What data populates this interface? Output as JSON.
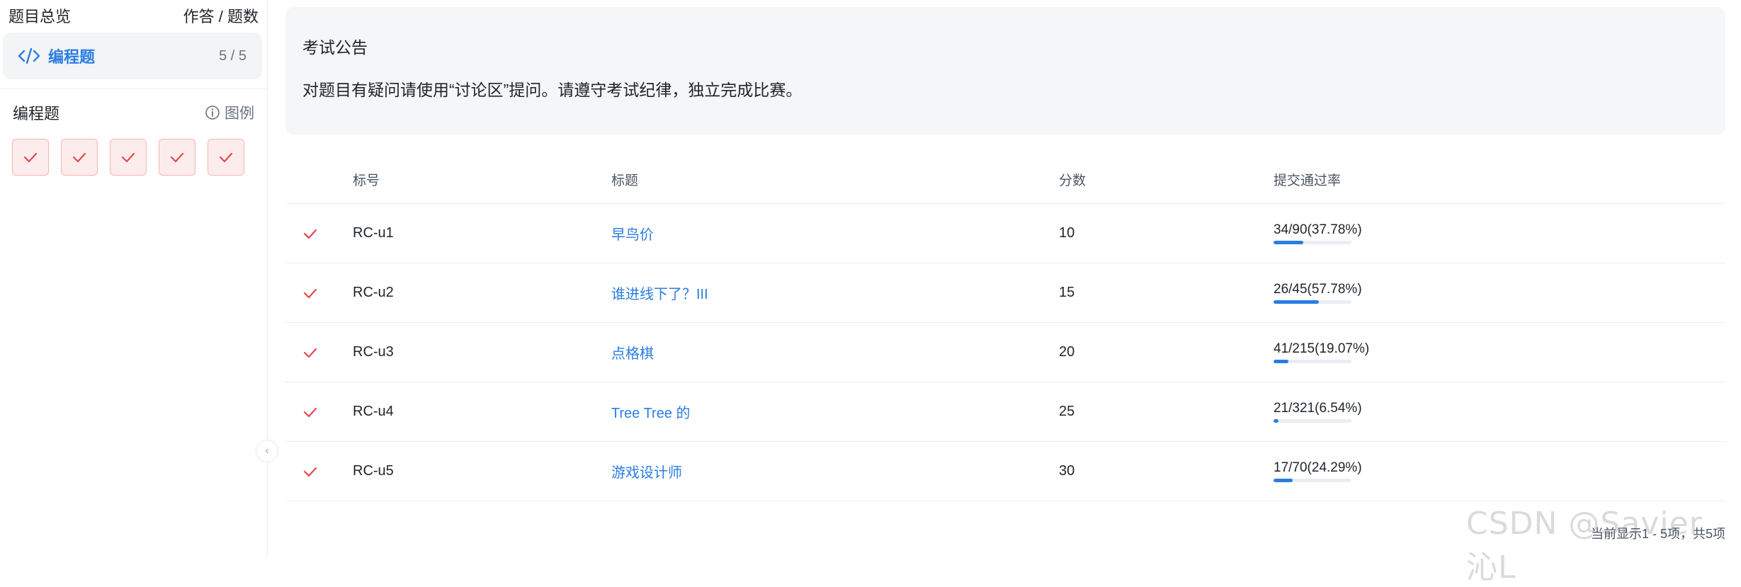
{
  "sidebar": {
    "header_title": "题目总览",
    "header_right": "作答 / 题数",
    "category": {
      "label": "编程题",
      "count": "5 / 5",
      "icon": "code-icon"
    },
    "section_title": "编程题",
    "legend_label": "图例",
    "question_boxes": [
      {
        "status": "passed",
        "icon": "check-icon"
      },
      {
        "status": "passed",
        "icon": "check-icon"
      },
      {
        "status": "passed",
        "icon": "check-icon"
      },
      {
        "status": "passed",
        "icon": "check-icon"
      },
      {
        "status": "passed",
        "icon": "check-icon"
      }
    ],
    "collapse_glyph": "‹"
  },
  "notice": {
    "title": "考试公告",
    "body": "对题目有疑问请使用“讨论区”提问。请遵守考试纪律，独立完成比赛。"
  },
  "table": {
    "headers": {
      "id": "标号",
      "title": "标题",
      "score": "分数",
      "rate": "提交通过率"
    },
    "rows": [
      {
        "id": "RC-u1",
        "title": "早鸟价",
        "score": "10",
        "rate": "34/90(37.78%)",
        "rate_fraction": 0.3778
      },
      {
        "id": "RC-u2",
        "title": "谁进线下了？III",
        "score": "15",
        "rate": "26/45(57.78%)",
        "rate_fraction": 0.5778
      },
      {
        "id": "RC-u3",
        "title": "点格棋",
        "score": "20",
        "rate": "41/215(19.07%)",
        "rate_fraction": 0.1907
      },
      {
        "id": "RC-u4",
        "title": "Tree Tree 的",
        "score": "25",
        "rate": "21/321(6.54%)",
        "rate_fraction": 0.0654
      },
      {
        "id": "RC-u5",
        "title": "游戏设计师",
        "score": "30",
        "rate": "17/70(24.29%)",
        "rate_fraction": 0.2429
      }
    ]
  },
  "pagination": {
    "info": "当前显示1 - 5项，共5项"
  },
  "watermark": "CSDN @Savier 沁L",
  "colors": {
    "accent": "#2a7de1",
    "passed": "#e5484d",
    "box_bg": "#fdecec"
  }
}
